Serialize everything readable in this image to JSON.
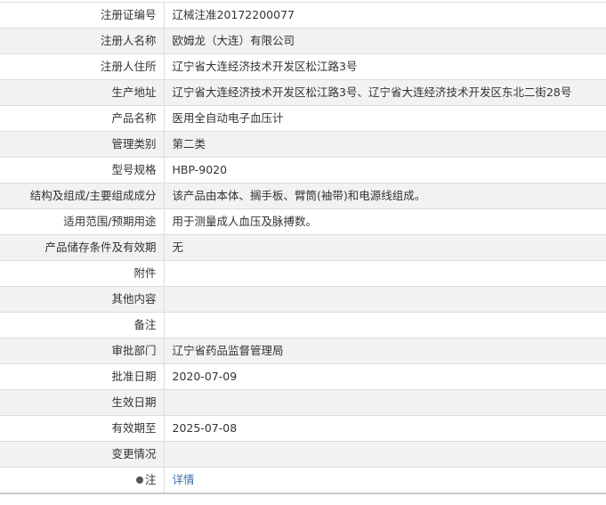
{
  "rows": [
    {
      "label": "注册证编号",
      "value": "辽械注准20172200077"
    },
    {
      "label": "注册人名称",
      "value": "欧姆龙（大连）有限公司"
    },
    {
      "label": "注册人住所",
      "value": "辽宁省大连经济技术开发区松江路3号"
    },
    {
      "label": "生产地址",
      "value": "辽宁省大连经济技术开发区松江路3号、辽宁省大连经济技术开发区东北二街28号"
    },
    {
      "label": "产品名称",
      "value": "医用全自动电子血压计"
    },
    {
      "label": "管理类别",
      "value": "第二类"
    },
    {
      "label": "型号规格",
      "value": "HBP-9020"
    },
    {
      "label": "结构及组成/主要组成成分",
      "value": "该产品由本体、搁手板、臂筒(袖带)和电源线组成。"
    },
    {
      "label": "适用范围/预期用途",
      "value": "用于测量成人血压及脉搏数。"
    },
    {
      "label": "产品储存条件及有效期",
      "value": "无"
    },
    {
      "label": "附件",
      "value": ""
    },
    {
      "label": "其他内容",
      "value": ""
    },
    {
      "label": "备注",
      "value": ""
    },
    {
      "label": "审批部门",
      "value": "辽宁省药品监督管理局"
    },
    {
      "label": "批准日期",
      "value": "2020-07-09"
    },
    {
      "label": "生效日期",
      "value": ""
    },
    {
      "label": "有效期至",
      "value": "2025-07-08"
    },
    {
      "label": "变更情况",
      "value": ""
    }
  ],
  "note": {
    "label": "注",
    "link": "详情",
    "icon": "info-dot-icon",
    "link_color": "#3a6fb0"
  }
}
